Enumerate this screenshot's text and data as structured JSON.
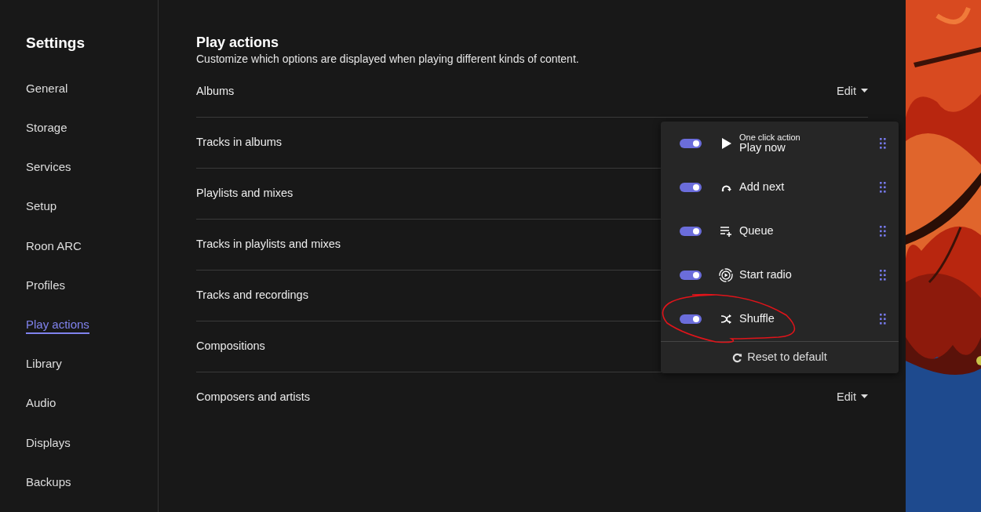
{
  "sidebar": {
    "title": "Settings",
    "items": [
      {
        "label": "General",
        "selected": false
      },
      {
        "label": "Storage",
        "selected": false
      },
      {
        "label": "Services",
        "selected": false
      },
      {
        "label": "Setup",
        "selected": false
      },
      {
        "label": "Roon ARC",
        "selected": false
      },
      {
        "label": "Profiles",
        "selected": false
      },
      {
        "label": "Play actions",
        "selected": true
      },
      {
        "label": "Library",
        "selected": false
      },
      {
        "label": "Audio",
        "selected": false
      },
      {
        "label": "Displays",
        "selected": false
      },
      {
        "label": "Backups",
        "selected": false
      }
    ]
  },
  "main": {
    "title": "Play actions",
    "subtitle": "Customize which options are displayed when playing different kinds of content.",
    "rows": [
      {
        "label": "Albums",
        "edit": "Edit"
      },
      {
        "label": "Tracks in albums"
      },
      {
        "label": "Playlists and mixes"
      },
      {
        "label": "Tracks in playlists and mixes"
      },
      {
        "label": "Tracks and recordings"
      },
      {
        "label": "Compositions"
      },
      {
        "label": "Composers and artists",
        "edit": "Edit"
      }
    ]
  },
  "popup": {
    "actions": [
      {
        "label": "Play now",
        "note": "One click action",
        "on": true
      },
      {
        "label": "Add next",
        "on": true
      },
      {
        "label": "Queue",
        "on": true
      },
      {
        "label": "Start radio",
        "on": true
      },
      {
        "label": "Shuffle",
        "on": true
      }
    ],
    "reset": "Reset to default"
  }
}
